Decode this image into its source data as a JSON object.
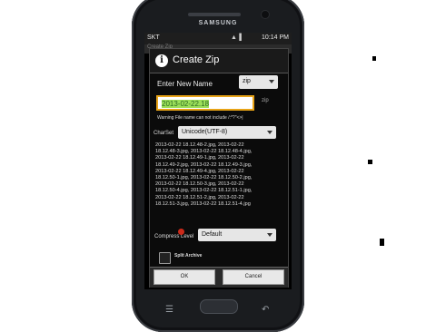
{
  "device": {
    "brand": "SAMSUNG"
  },
  "statusbar": {
    "carrier": "SKT",
    "signal": "▲▐",
    "time": "10:14 PM"
  },
  "background_title": "Create Zip",
  "dialog": {
    "title": "Create Zip",
    "enter_name_label": "Enter New Name",
    "format_value": "zip",
    "name_value": "2013-02-22.18",
    "side_char": "zip",
    "warning": "Warning File name can not include /:*?\"<>|",
    "charset_label": "CharSet",
    "charset_value": "Unicode(UTF-8)",
    "file_list": [
      "2013-02-22 18.12.48-2.jpg, 2013-02-22",
      "18.12.48-3.jpg, 2013-02-22 18.12.48-4.jpg,",
      "2013-02-22 18.12.49-1.jpg, 2013-02-22",
      "18.12.49-2.jpg, 2013-02-22 18.12.49-3.jpg,",
      "2013-02-22 18.12.49-4.jpg, 2013-02-22",
      "18.12.50-1.jpg, 2013-02-22 18.12.50-2.jpg,",
      "2013-02-22 18.12.50-3.jpg, 2013-02-22",
      "18.12.50-4.jpg, 2013-02-22 18.12.51-1.jpg,",
      "2013-02-22 18.12.51-2.jpg, 2013-02-22",
      "18.12.51-3.jpg, 2013-02-22 18.12.51-4.jpg"
    ],
    "compress_label": "Compress Level",
    "compress_value": "Default",
    "split_label": "Split Archive",
    "ok_label": "OK",
    "cancel_label": "Cancel"
  },
  "colors": {
    "input_border": "#e8a317",
    "text_green": "#2e8b2e",
    "red_dot": "#cc2a1a"
  }
}
